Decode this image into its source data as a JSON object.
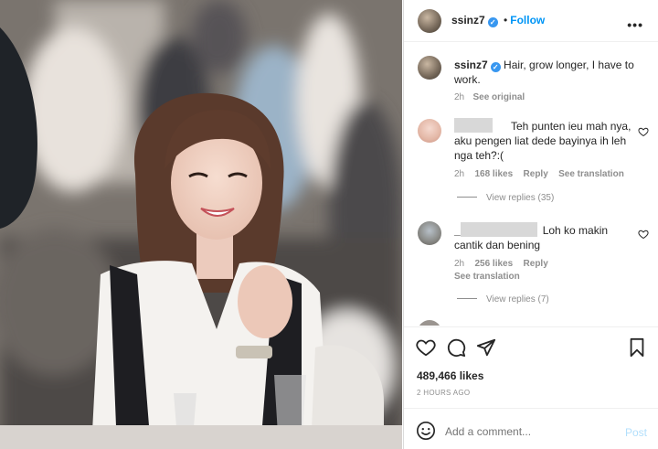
{
  "post": {
    "author": "ssinz7",
    "follow_label": "Follow",
    "caption": "Hair, grow longer, I have to work.",
    "caption_time": "2h",
    "see_original": "See original",
    "likes": "489,466 likes",
    "posted_ago": "2 HOURS AGO"
  },
  "comments": [
    {
      "text_line1": "Teh punten ieu mah nya,",
      "text_line2": "aku pengen liat dede bayinya ih leh",
      "text_line3": "nga teh?:(",
      "time": "2h",
      "likes": "168 likes",
      "reply": "Reply",
      "translation": "See translation",
      "view_replies": "View replies (35)"
    },
    {
      "username_prefix": "_",
      "text_inline": "Loh ko makin",
      "text_line2": "cantik dan bening",
      "time": "2h",
      "likes": "256 likes",
      "reply": "Reply",
      "translation": "See translation",
      "view_replies": "View replies (7)"
    }
  ],
  "composer": {
    "placeholder": "Add a comment...",
    "post_label": "Post"
  },
  "icons": {
    "like": "heart-icon",
    "comment": "comment-icon",
    "share": "paper-plane-icon",
    "save": "bookmark-icon",
    "more": "more-options-icon",
    "emoji": "emoji-icon"
  },
  "colors": {
    "accent": "#0095f6",
    "verified": "#3897f0",
    "muted": "#8e8e8e"
  }
}
